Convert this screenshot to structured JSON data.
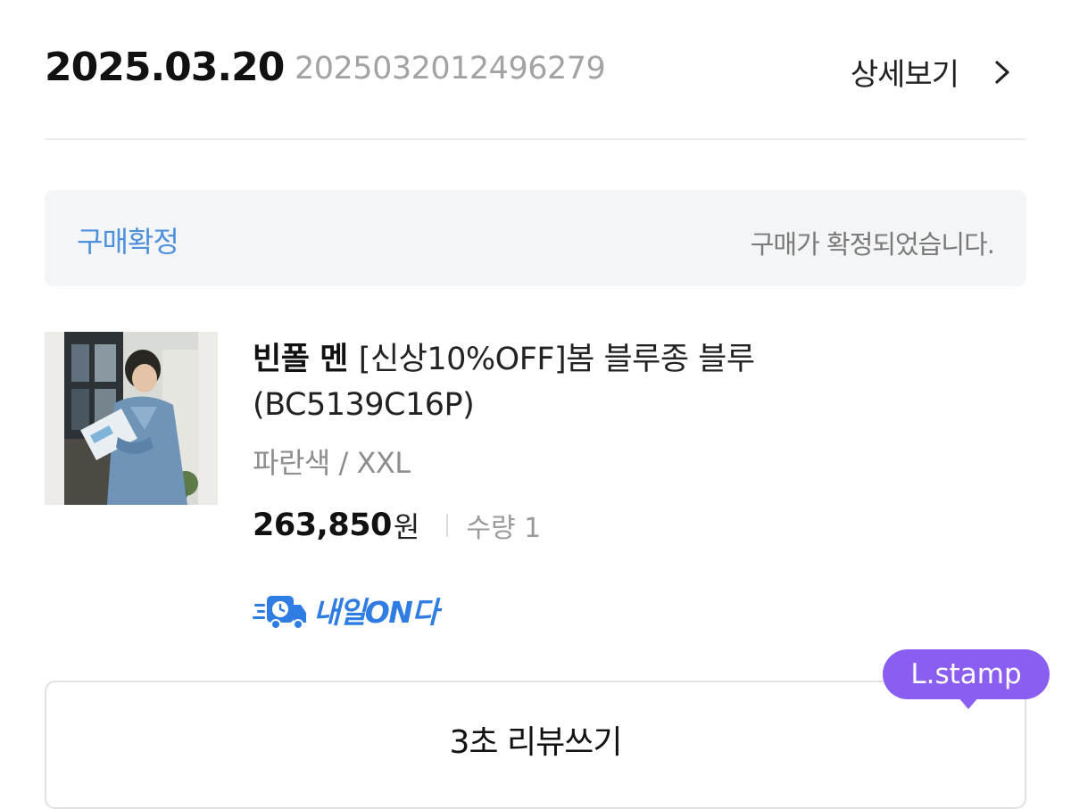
{
  "order": {
    "date": "2025.03.20",
    "number": "2025032012496279",
    "detail_label": "상세보기"
  },
  "status": {
    "label": "구매확정",
    "message": "구매가 확정되었습니다."
  },
  "product": {
    "brand": "빈폴 멘",
    "name": "[신상10%OFF]봄 블루종 블루 (BC5139C16P)",
    "option": "파란색 / XXL",
    "price": "263,850",
    "currency": "원",
    "quantity": "수량 1"
  },
  "delivery": {
    "label": "내일ON다"
  },
  "review": {
    "button_label": "3초 리뷰쓰기",
    "badge": "L.stamp"
  },
  "colors": {
    "status_blue": "#4f90dd",
    "delivery_blue": "#2f7de3",
    "stamp_purple": "#8b5ef2"
  }
}
